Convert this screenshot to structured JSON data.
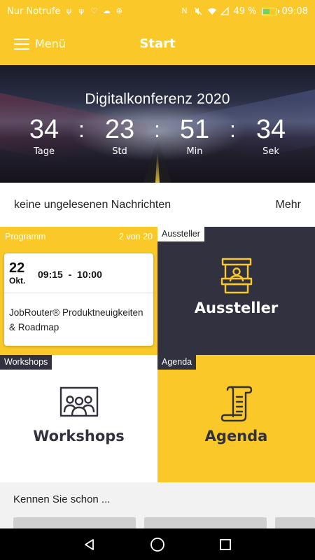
{
  "status_bar": {
    "carrier": "Nur Notrufe",
    "battery": "49 %",
    "battery_level": 0.49,
    "time": "09:08",
    "icons": [
      "usb-icon",
      "usb-icon",
      "heart-icon",
      "cloud-icon",
      "record-icon",
      "nfc-icon",
      "mute-icon",
      "wifi-icon",
      "no-signal-icon",
      "battery-icon"
    ]
  },
  "app_bar": {
    "menu_label": "Menü",
    "title": "Start"
  },
  "hero": {
    "title": "Digitalkonferenz 2020",
    "countdown": [
      {
        "value": "34",
        "label": "Tage"
      },
      {
        "value": "23",
        "label": "Std"
      },
      {
        "value": "51",
        "label": "Min"
      },
      {
        "value": "34",
        "label": "Sek"
      }
    ],
    "separator": ":"
  },
  "messages": {
    "text": "keine ungelesenen Nachrichten",
    "more_label": "Mehr"
  },
  "tiles": {
    "programm": {
      "label": "Programm",
      "counter": "2 von 20",
      "card": {
        "day": "22",
        "month": "Okt.",
        "time_start": "09:15",
        "time_sep": "-",
        "time_end": "10:00",
        "title": "JobRouter® Produktneuigkeiten & Roadmap"
      }
    },
    "aussteller": {
      "tag": "Aussteller",
      "label": "Aussteller",
      "icon": "exhibitor-booth-icon"
    },
    "workshops": {
      "tag": "Workshops",
      "label": "Workshops",
      "icon": "group-people-icon"
    },
    "agenda": {
      "tag": "Agenda",
      "label": "Agenda",
      "icon": "scroll-document-icon"
    }
  },
  "discover": {
    "title": "Kennen Sie schon ..."
  },
  "nav_bar": {
    "icons": [
      "back-icon",
      "home-icon",
      "recents-icon"
    ]
  },
  "colors": {
    "accent": "#fac929",
    "dark_tile": "#31313f",
    "text": "#222222"
  }
}
